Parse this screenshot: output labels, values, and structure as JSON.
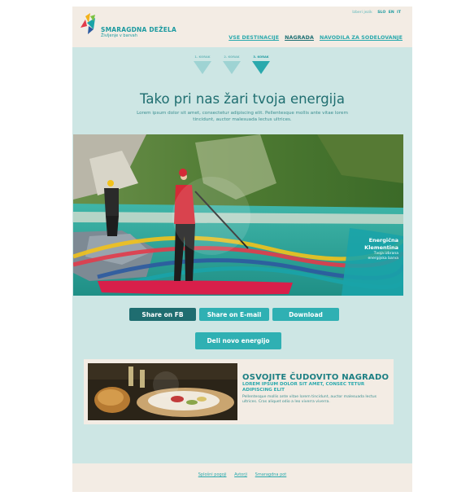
{
  "header": {
    "brand_title": "SMARAGDNA DEŽELA",
    "brand_subtitle": "Življenje v barvah",
    "lang_label": "Izberi jezik",
    "languages": [
      "SLO",
      "EN",
      "IT"
    ],
    "nav": [
      "VSE DESTINACIJE",
      "NAGRADA",
      "NAVODILA ZA SODELOVANJE"
    ]
  },
  "steps": [
    "1. KORAK",
    "2. KORAK",
    "3. KORAK"
  ],
  "main": {
    "headline": "Tako pri nas žari tvoja energija",
    "lead": "Lorem ipsum dolor sit amet, consectetur adipiscing elit. Pellentesque mollis ante vitae lorem tincidunt, auctor malesuada lectus ultrices."
  },
  "hero": {
    "badge_line1": "Energična",
    "badge_line2": "Klementina",
    "badge_small1": "Tvoja izbrana",
    "badge_small2": "energijska barva"
  },
  "actions": {
    "share_fb": "Share on FB",
    "share_email": "Share on E-mail",
    "download": "Download",
    "new_energy": "Deli novo energijo"
  },
  "promo": {
    "title": "OSVOJITE ČUDOVITO NAGRADO",
    "subtitle": "LOREM IPSUM DOLOR SIT AMET, CONSEC TETUR ADIPISCING ELIT",
    "body": "Pellentesque mollis ante vitae lorem tincidunt, auctor malesuada lectus ultrices. Cras aliquet odio a leo viverra viverra."
  },
  "footer": {
    "links": [
      "Splošni pogoji",
      "Avtorji",
      "Smaragdna pot"
    ]
  },
  "colors": {
    "accent": "#2aa9ad",
    "accent_dark": "#1f6d70",
    "background": "#cde6e4",
    "header_bg": "#f3ece4"
  }
}
